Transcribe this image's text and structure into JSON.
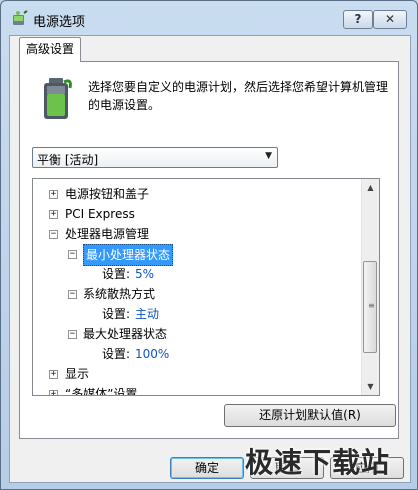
{
  "window": {
    "title": "电源选项"
  },
  "tab": {
    "label": "高级设置"
  },
  "description": "选择您要自定义的电源计划，然后选择您希望计算机管理的电源设置。",
  "plan_select": {
    "value": "平衡 [活动]"
  },
  "tree": {
    "items": [
      {
        "label": "电源按钮和盖子",
        "expander": "+"
      },
      {
        "label": "PCI Express",
        "expander": "+"
      },
      {
        "label": "处理器电源管理",
        "expander": "−"
      },
      {
        "label": "最小处理器状态",
        "expander": "−"
      },
      {
        "setting_label": "设置:",
        "setting_value": "5%"
      },
      {
        "label": "系统散热方式",
        "expander": "−"
      },
      {
        "setting_label": "设置:",
        "setting_value": "主动"
      },
      {
        "label": "最大处理器状态",
        "expander": "−"
      },
      {
        "setting_label": "设置:",
        "setting_value": "100%"
      },
      {
        "label": "显示",
        "expander": "+"
      },
      {
        "label": "“多媒体”设置",
        "expander": "+"
      }
    ]
  },
  "buttons": {
    "restore": "还原计划默认值(R)",
    "ok": "确定",
    "cancel": "取消",
    "apply": "应用"
  },
  "titlebar_buttons": {
    "help": "?",
    "close": "✕"
  },
  "watermark": "极速下载站"
}
